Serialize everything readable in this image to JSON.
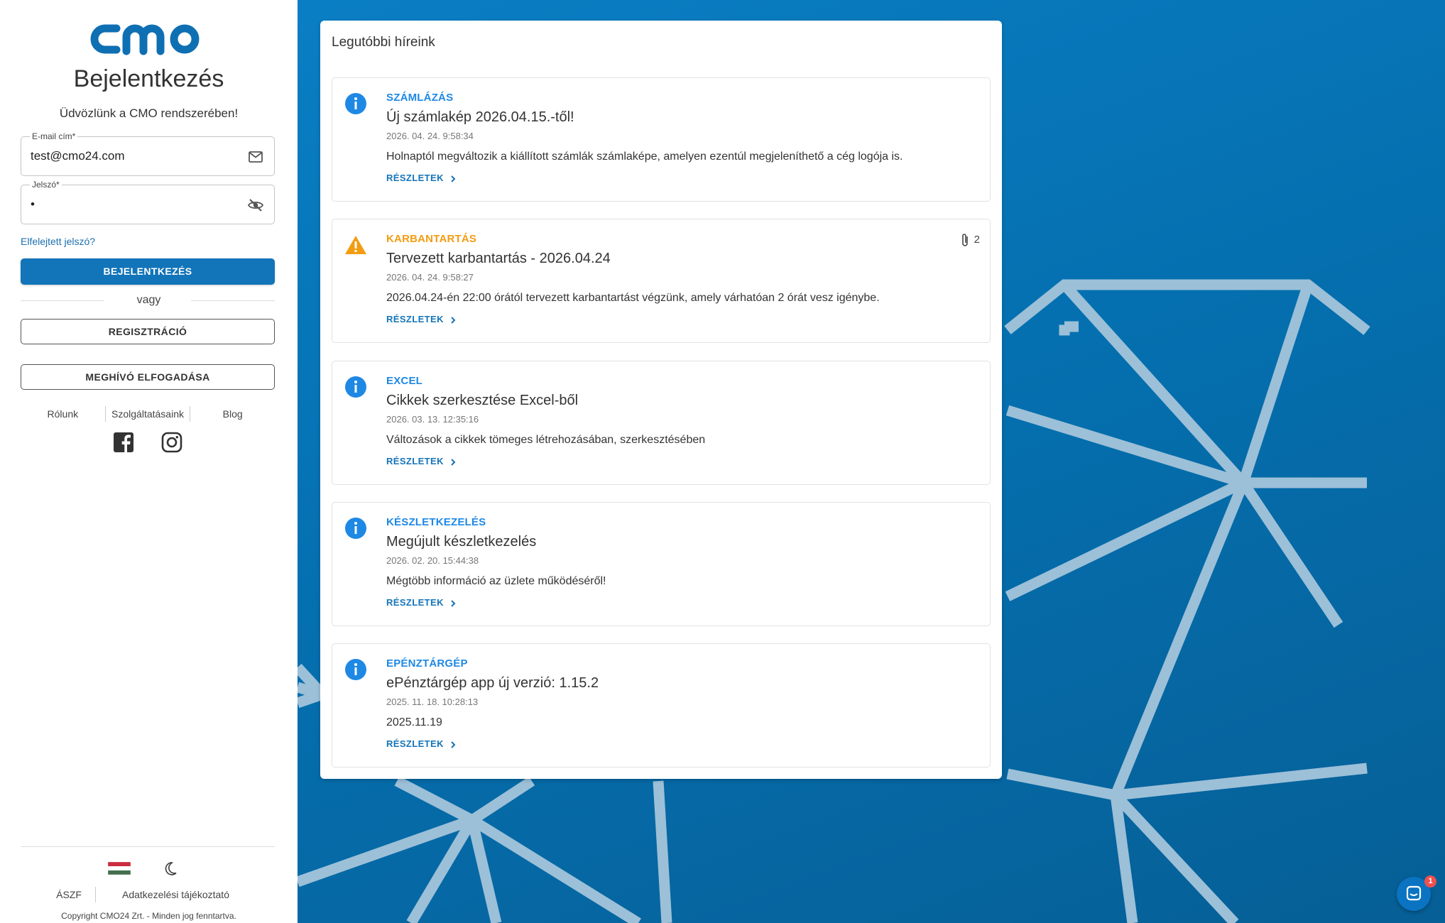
{
  "login": {
    "title": "Bejelentkezés",
    "subtitle": "Üdvözlünk a CMO rendszerében!",
    "email_label": "E-mail cím*",
    "email_value": "test@cmo24.com",
    "password_label": "Jelszó*",
    "password_value": "•",
    "forgot": "Elfelejtett jelszó?",
    "login_button": "BEJELENTKEZÉS",
    "or": "vagy",
    "register_button": "REGISZTRÁCIÓ",
    "invite_button": "MEGHÍVÓ ELFOGADÁSA",
    "links": [
      "Rólunk",
      "Szolgáltatásaink",
      "Blog"
    ],
    "footer_links": [
      "ÁSZF",
      "Adatkezelési tájékoztató"
    ],
    "copyright": "Copyright CMO24 Zrt. - Minden jog fenntartva."
  },
  "news": {
    "heading": "Legutóbbi híreink",
    "details_label": "RÉSZLETEK",
    "items": [
      {
        "type": "info",
        "category": "SZÁMLÁZÁS",
        "title": "Új számlakép 2026.04.15.-től!",
        "date": "2026. 04. 24. 9:58:34",
        "text": "Holnaptól megváltozik a kiállított számlák számlaképe, amelyen ezentúl megjeleníthető a cég logója is."
      },
      {
        "type": "warning",
        "category": "KARBANTARTÁS",
        "title": "Tervezett karbantartás - 2026.04.24",
        "date": "2026. 04. 24. 9:58:27",
        "text": "2026.04.24-én 22:00 órától tervezett karbantartást végzünk, amely várhatóan 2 órát vesz igénybe.",
        "attachments": "2"
      },
      {
        "type": "info",
        "category": "EXCEL",
        "title": "Cikkek szerkesztése Excel-ből",
        "date": "2026. 03. 13. 12:35:16",
        "text": "Változások a cikkek tömeges létrehozásában, szerkesztésében"
      },
      {
        "type": "info",
        "category": "KÉSZLETKEZELÉS",
        "title": "Megújult készletkezelés",
        "date": "2026. 02. 20. 15:44:38",
        "text": "Mégtöbb információ az üzlete működéséről!"
      },
      {
        "type": "info",
        "category": "EPÉNZTÁRGÉP",
        "title": "ePénztárgép app új verzió: 1.15.2",
        "date": "2025. 11. 18. 10:28:13",
        "text": "2025.11.19"
      }
    ]
  },
  "chat": {
    "badge": "1"
  },
  "colors": {
    "accent": "#1274b9",
    "info": "#1e88e5",
    "warning": "#f39c12",
    "category_info": "#1e88e5",
    "category_warning": "#f39c12"
  }
}
